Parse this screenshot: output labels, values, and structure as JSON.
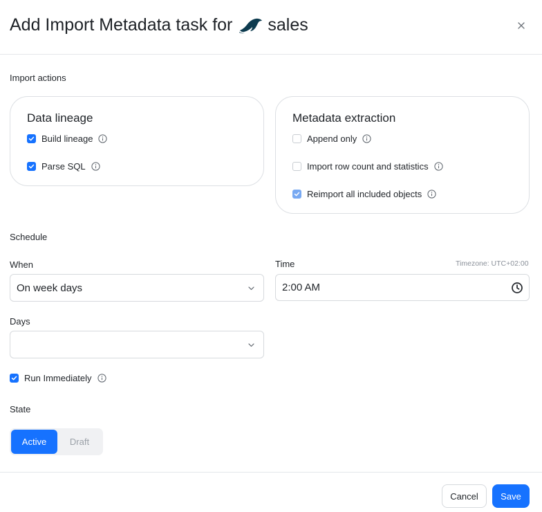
{
  "header": {
    "title": "Add Import Metadata task for",
    "database_name": "sales",
    "database_logo_icon": "mariadb-seal-icon",
    "close_icon": "close-icon"
  },
  "import_actions": {
    "label": "Import actions",
    "data_lineage": {
      "title": "Data lineage",
      "options": [
        {
          "label": "Build lineage",
          "checked": true
        },
        {
          "label": "Parse SQL",
          "checked": true
        }
      ]
    },
    "metadata_extraction": {
      "title": "Metadata extraction",
      "options": [
        {
          "label": "Append only",
          "checked": false
        },
        {
          "label": "Import row count and statistics",
          "checked": false
        },
        {
          "label": "Reimport all included objects",
          "checked": true,
          "disabled": true
        }
      ]
    }
  },
  "schedule": {
    "label": "Schedule",
    "when": {
      "label": "When",
      "value": "On week days"
    },
    "time": {
      "label": "Time",
      "value": "2:00 AM",
      "timezone": "Timezone: UTC+02:00"
    },
    "days": {
      "label": "Days",
      "value": ""
    },
    "run_immediately": {
      "label": "Run Immediately",
      "checked": true
    }
  },
  "state": {
    "label": "State",
    "options": [
      "Active",
      "Draft"
    ],
    "selected": "Active"
  },
  "footer": {
    "cancel_label": "Cancel",
    "save_label": "Save"
  },
  "colors": {
    "accent": "#1672ff",
    "logo": "#0d3b4f",
    "border": "#dcdfe3"
  }
}
